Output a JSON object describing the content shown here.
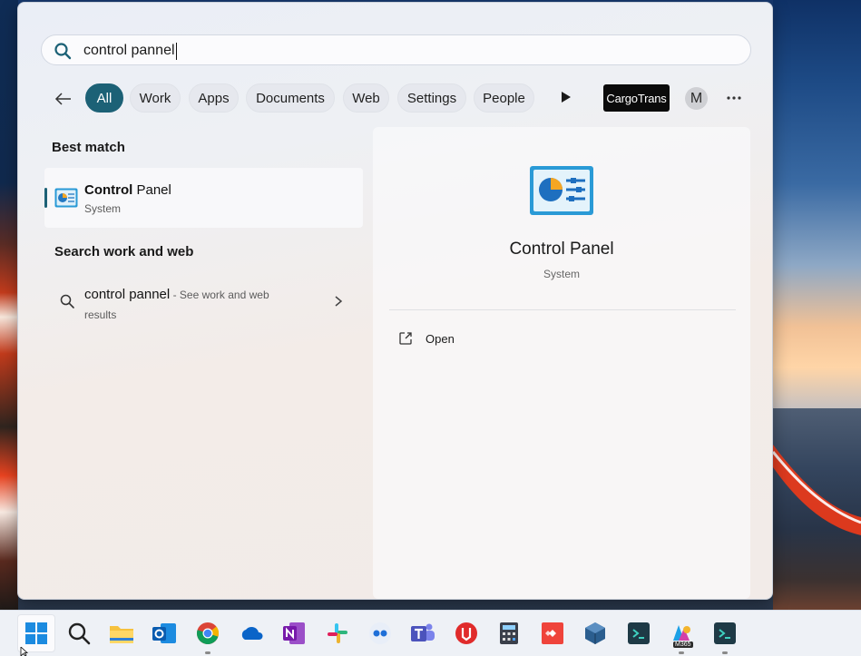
{
  "search": {
    "query": "control pannel"
  },
  "filters": {
    "chips": [
      "All",
      "Work",
      "Apps",
      "Documents",
      "Web",
      "Settings",
      "People"
    ],
    "active": "All",
    "cargo_label": "CargoTrans",
    "avatar_initial": "M"
  },
  "left": {
    "best_match_title": "Best match",
    "best_match": {
      "name_bold": "Control",
      "name_rest": " Panel",
      "category": "System"
    },
    "web_section_title": "Search work and web",
    "web_item": {
      "query": "control pannel",
      "hint_line1": " - See work and web",
      "hint_line2": "results"
    }
  },
  "detail": {
    "title": "Control Panel",
    "subtitle": "System",
    "actions": [
      {
        "label": "Open",
        "icon": "open-external-icon"
      }
    ]
  },
  "taskbar": {
    "apps": [
      {
        "name": "start",
        "icon": "windows-start-icon"
      },
      {
        "name": "search",
        "icon": "search-icon"
      },
      {
        "name": "file-explorer",
        "icon": "folder-icon"
      },
      {
        "name": "outlook",
        "icon": "outlook-icon"
      },
      {
        "name": "chrome",
        "icon": "chrome-icon"
      },
      {
        "name": "onedrive",
        "icon": "onedrive-icon"
      },
      {
        "name": "onenote",
        "icon": "onenote-icon"
      },
      {
        "name": "slack",
        "icon": "slack-icon"
      },
      {
        "name": "dots-app",
        "icon": "dots-app-icon"
      },
      {
        "name": "teams",
        "icon": "teams-icon"
      },
      {
        "name": "download-app",
        "icon": "download-app-icon"
      },
      {
        "name": "calculator",
        "icon": "calculator-icon"
      },
      {
        "name": "anydesk",
        "icon": "anydesk-icon"
      },
      {
        "name": "virtualbox",
        "icon": "virtualbox-icon"
      },
      {
        "name": "terminal-app",
        "icon": "terminal-app-icon"
      },
      {
        "name": "m365",
        "icon": "m365-icon",
        "badge": "M365"
      },
      {
        "name": "terminal-app-2",
        "icon": "terminal-app-icon"
      }
    ]
  },
  "colors": {
    "accent": "#1c6176",
    "panel_bg": "#eef0f4"
  }
}
